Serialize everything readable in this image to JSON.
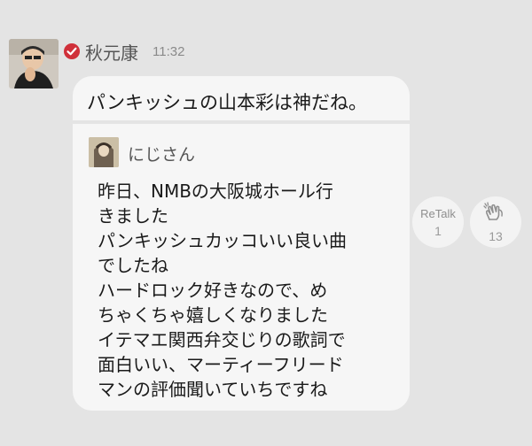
{
  "post": {
    "sender_name": "秋元康",
    "timestamp": "11:32",
    "message": "パンキッシュの山本彩は神だね。"
  },
  "quote": {
    "name": "にじさん",
    "lines": [
      "昨日、NMBの大阪城ホール行",
      "きました",
      "パンキッシュカッコいい良い曲",
      "でしたね",
      "ハードロック好きなので、め",
      "ちゃくちゃ嬉しくなりました",
      "イテマエ関西弁交じりの歌詞で",
      "面白いい、マーティーフリード",
      "マンの評価聞いていちですね"
    ]
  },
  "actions": {
    "retalk_label": "ReTalk",
    "retalk_count": "1",
    "clap_count": "13"
  },
  "colors": {
    "background": "#e4e4e4",
    "bubble": "#f6f6f6",
    "verified_badge": "#d0303a"
  },
  "icons": {
    "verified": "verified-check-icon",
    "clap": "clap-icon"
  }
}
